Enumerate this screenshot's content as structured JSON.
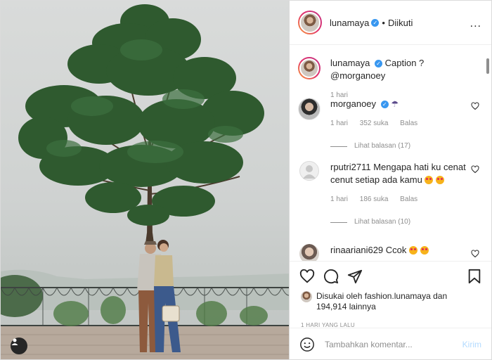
{
  "header": {
    "username": "lunamaya",
    "separator": "•",
    "follow_status": "Diikuti",
    "more_label": "..."
  },
  "caption": {
    "username": "lunamaya",
    "text": "Caption ? @morganoey",
    "time": "1 hari"
  },
  "comments": [
    {
      "username": "morganoey",
      "text": "",
      "time": "1 hari",
      "likes": "352 suka",
      "reply_label": "Balas",
      "view_replies": "Lihat balasan (17)"
    },
    {
      "username": "rputri2711",
      "text": "Mengapa hati ku cenat cenut setiap ada kamu",
      "time": "1 hari",
      "likes": "186 suka",
      "reply_label": "Balas",
      "view_replies": "Lihat balasan (10)"
    },
    {
      "username": "rinaariani629",
      "text": "Ccok"
    }
  ],
  "liked_by": {
    "prefix": "Disukai oleh",
    "user": "fashion.lunamaya",
    "mid": "dan",
    "count": "194,914",
    "suffix": "lainnya"
  },
  "post_time": "1 HARI YANG LALU",
  "comment_input": {
    "placeholder": "Tambahkan komentar...",
    "post_label": "Kirim"
  },
  "icons": {
    "like": "heart-icon",
    "comment": "comment-icon",
    "share": "share-icon",
    "save": "bookmark-icon",
    "emoji": "smiley-icon",
    "user_tag": "user-tag-icon",
    "more": "more-options-icon"
  },
  "colors": {
    "verified": "#3897f0",
    "secondary_text": "#8e8e8e",
    "post_button_disabled": "#b3dbff"
  }
}
